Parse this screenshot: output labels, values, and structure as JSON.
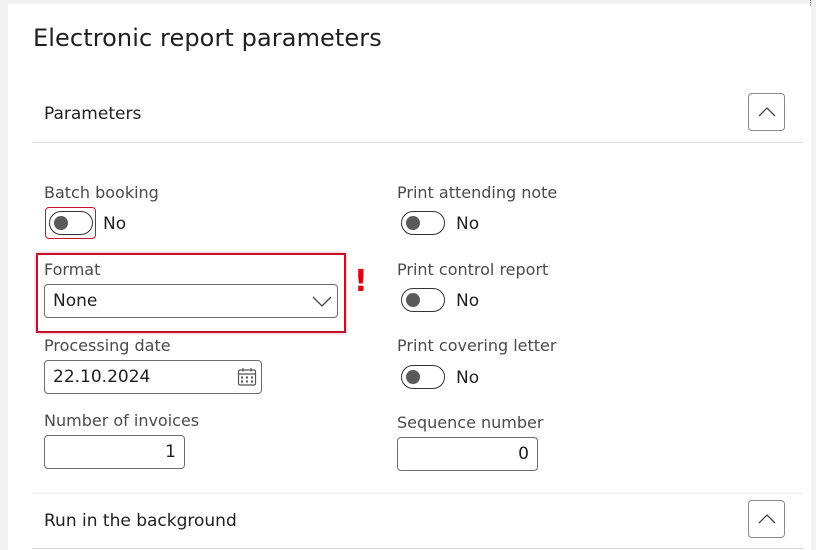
{
  "dialog": {
    "title": "Electronic report parameters"
  },
  "parameters_section": {
    "label": "Parameters",
    "collapse_icon": "chevron-up-icon"
  },
  "fields": {
    "batch_booking": {
      "label": "Batch booking",
      "value": "No",
      "on": false
    },
    "format": {
      "label": "Format",
      "value": "None",
      "warning": "!"
    },
    "processing_date": {
      "label": "Processing date",
      "value": "22.10.2024",
      "icon": "calendar-icon"
    },
    "number_of_invoices": {
      "label": "Number of invoices",
      "value": "1"
    },
    "print_attending_note": {
      "label": "Print attending note",
      "value": "No",
      "on": false
    },
    "print_control_report": {
      "label": "Print control report",
      "value": "No",
      "on": false
    },
    "print_covering_letter": {
      "label": "Print covering letter",
      "value": "No",
      "on": false
    },
    "sequence_number": {
      "label": "Sequence number",
      "value": "0"
    }
  },
  "background_section": {
    "label": "Run in the background",
    "collapse_icon": "chevron-up-icon"
  },
  "colors": {
    "highlight": "#c8102e",
    "warning": "#e3000f"
  }
}
